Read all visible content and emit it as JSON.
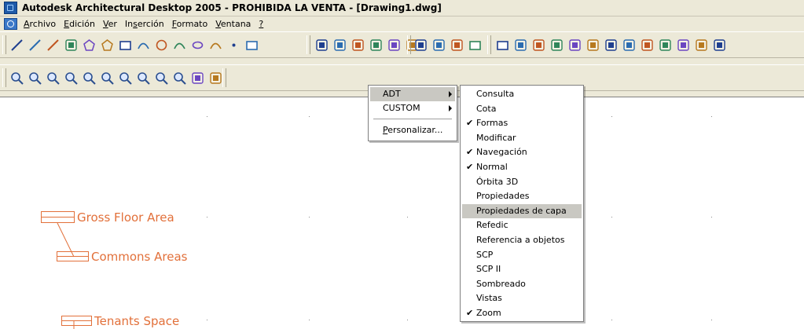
{
  "window": {
    "title": "Autodesk Architectural Desktop 2005 - PROHIBIDA LA VENTA - [Drawing1.dwg]",
    "app_icon": "autodesk-app-icon"
  },
  "menubar": {
    "items": [
      {
        "mnemonic": "A",
        "rest": "rchivo"
      },
      {
        "mnemonic": "E",
        "rest": "dición"
      },
      {
        "mnemonic": "V",
        "rest": "er"
      },
      {
        "pre": "In",
        "mnemonic": "s",
        "rest": "erción"
      },
      {
        "mnemonic": "F",
        "rest": "ormato"
      },
      {
        "mnemonic": "V",
        "rest": "entana"
      },
      {
        "mnemonic": "?",
        "rest": ""
      }
    ]
  },
  "toolbars": {
    "draw_icons": [
      "line-icon",
      "construction-line-icon",
      "polyline-icon",
      "multiline-icon",
      "polygon-icon",
      "polygon2-icon",
      "rectangle-icon",
      "arc-icon",
      "circle-icon",
      "spline-icon",
      "ellipse-icon",
      "revcloud-icon",
      "point-icon",
      "region-icon"
    ],
    "row1_icons2": [
      "block-icon",
      "layers-icon",
      "properties-icon",
      "design-center-icon",
      "tool-palette-icon",
      "sheet-icon"
    ],
    "row1_icons3": [
      "snap-icon",
      "match-icon",
      "ucs-icon",
      "frame-icon"
    ],
    "row1_icons4": [
      "new-icon",
      "open-icon",
      "save-icon",
      "print-icon",
      "preview-icon",
      "publish-icon",
      "spell-icon",
      "find-icon",
      "plot-icon",
      "cut-icon",
      "copy-icon",
      "paste-icon",
      "brush-icon"
    ],
    "zoom_icons": [
      "zoom-realtime-icon",
      "zoom-window-icon",
      "zoom-dynamic-icon",
      "zoom-scale-icon",
      "zoom-center-icon",
      "zoom-object-icon",
      "zoom-in-icon",
      "zoom-out-icon",
      "zoom-all-icon",
      "zoom-extents-icon",
      "pan-icon",
      "orbit-icon"
    ]
  },
  "context_menu": {
    "items": [
      {
        "label": "ADT",
        "has_submenu": true,
        "highlighted": true
      },
      {
        "label": "CUSTOM",
        "has_submenu": true,
        "highlighted": false
      }
    ],
    "personalize": {
      "mnemonic": "P",
      "rest": "ersonalizar..."
    }
  },
  "sub_menu": {
    "items": [
      {
        "label": "Consulta",
        "checked": false,
        "highlighted": false
      },
      {
        "label": "Cota",
        "checked": false,
        "highlighted": false
      },
      {
        "label": "Formas",
        "checked": true,
        "highlighted": false
      },
      {
        "label": "Modificar",
        "checked": false,
        "highlighted": false
      },
      {
        "label": "Navegación",
        "checked": true,
        "highlighted": false
      },
      {
        "label": "Normal",
        "checked": true,
        "highlighted": false
      },
      {
        "label": "Órbita 3D",
        "checked": false,
        "highlighted": false
      },
      {
        "label": "Propiedades",
        "checked": false,
        "highlighted": false
      },
      {
        "label": "Propiedades de capa",
        "checked": false,
        "highlighted": true
      },
      {
        "label": "Refedic",
        "checked": false,
        "highlighted": false
      },
      {
        "label": "Referencia a objetos",
        "checked": false,
        "highlighted": false
      },
      {
        "label": "SCP",
        "checked": false,
        "highlighted": false
      },
      {
        "label": "SCP II",
        "checked": false,
        "highlighted": false
      },
      {
        "label": "Sombreado",
        "checked": false,
        "highlighted": false
      },
      {
        "label": "Vistas",
        "checked": false,
        "highlighted": false
      },
      {
        "label": "Zoom",
        "checked": true,
        "highlighted": false
      }
    ],
    "check_glyph": "✔"
  },
  "drawing": {
    "labels": [
      "Gross Floor Area",
      "Commons Areas",
      "Tenants Space"
    ],
    "tag_color": "#e2703a"
  },
  "colors": {
    "highlight": "#c9c8c2",
    "chrome": "#ece9d8"
  }
}
